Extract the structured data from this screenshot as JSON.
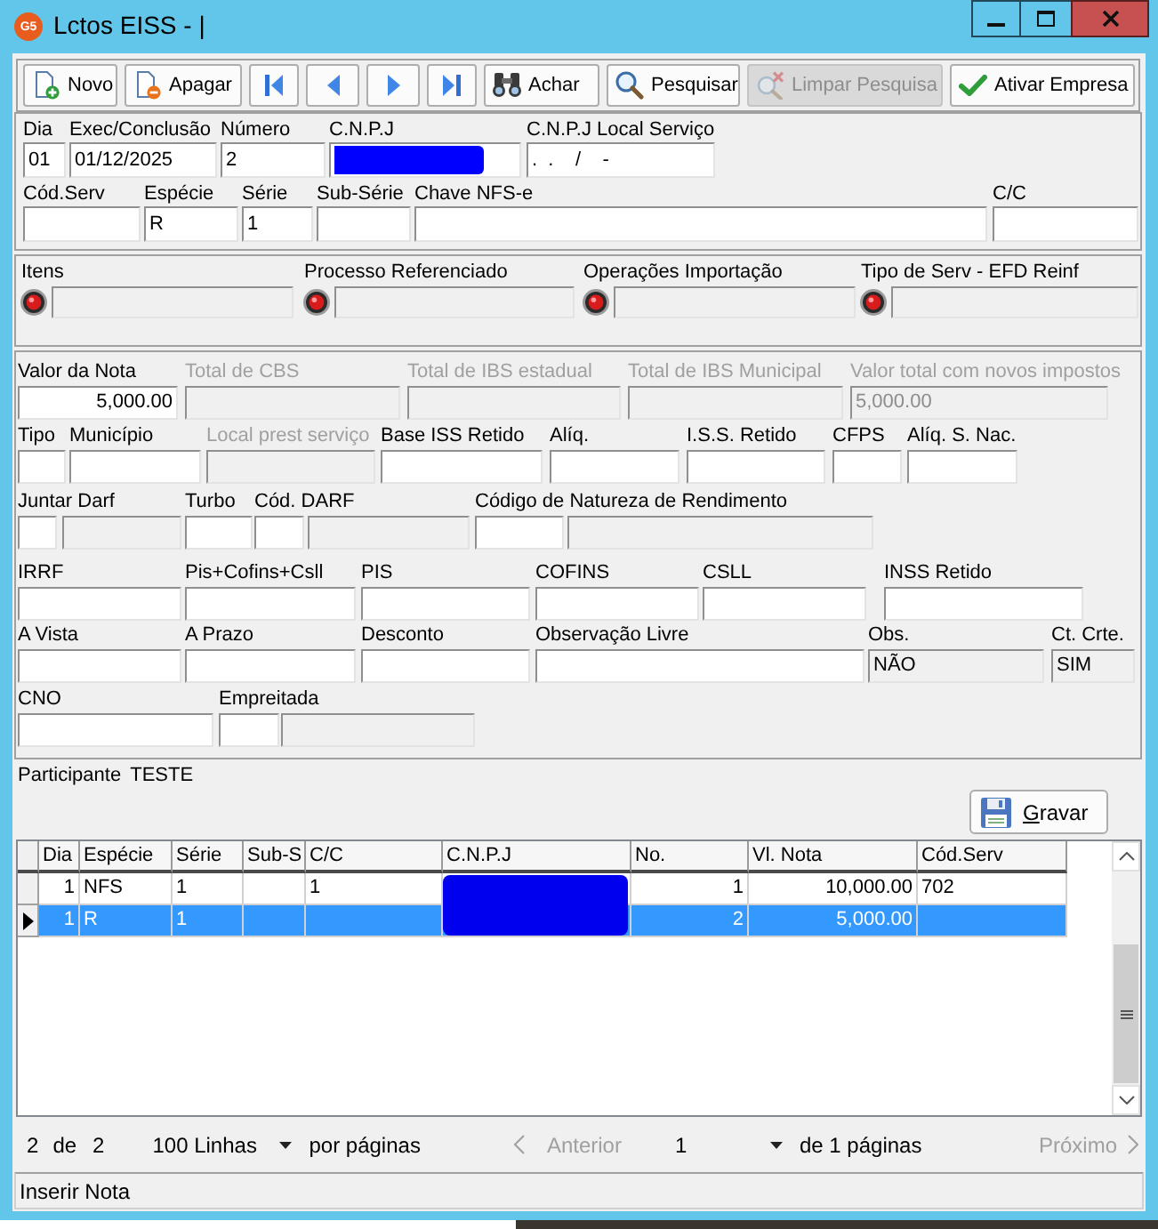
{
  "window": {
    "logo": "G5",
    "title": "Lctos EISS - |"
  },
  "toolbar": [
    {
      "kind": "new",
      "label": "Novo",
      "disabled": false
    },
    {
      "kind": "delete",
      "label": "Apagar",
      "disabled": false
    },
    {
      "kind": "first",
      "disabled": false
    },
    {
      "kind": "previous",
      "disabled": false
    },
    {
      "kind": "next",
      "disabled": false
    },
    {
      "kind": "last",
      "disabled": false
    },
    {
      "kind": "find",
      "label": "Achar",
      "disabled": false
    },
    {
      "kind": "search",
      "label": "Pesquisar",
      "disabled": false
    },
    {
      "kind": "clear",
      "label": "Limpar Pesquisa",
      "disabled": true
    },
    {
      "kind": "activate",
      "label": "Ativar Empresa",
      "disabled": false
    }
  ],
  "header": [
    [
      {
        "kind": "input",
        "label": "Dia",
        "value": "01"
      },
      {
        "kind": "input",
        "label": "Exec/Conclusão",
        "value": "01/12/2025"
      },
      {
        "kind": "input",
        "label": "Número",
        "value": "2"
      },
      {
        "kind": "redacted",
        "label": "C.N.P.J"
      },
      {
        "kind": "input",
        "label": "C.N.P.J Local Serviço",
        "value": ".  .    /    -"
      }
    ],
    [
      {
        "kind": "input",
        "label": "Cód.Serv"
      },
      {
        "kind": "input",
        "label": "Espécie",
        "value": "R"
      },
      {
        "kind": "input",
        "label": "Série",
        "value": "1"
      },
      {
        "kind": "input",
        "label": "Sub-Série"
      },
      {
        "kind": "input",
        "label": "Chave NFS-e"
      },
      {
        "kind": "input",
        "label": "C/C"
      }
    ]
  ],
  "item_links": [
    {
      "label": "Itens"
    },
    {
      "label": "Processo Referenciado"
    },
    {
      "label": "Operações Importação"
    },
    {
      "label": "Tipo de Serv - EFD Reinf"
    }
  ],
  "values": [
    [
      {
        "kind": "input",
        "label": "Valor da Nota",
        "value": "5,000.00"
      },
      {
        "kind": "disabled",
        "label": "Total de CBS"
      },
      {
        "kind": "disabled",
        "label": "Total de IBS estadual"
      },
      {
        "kind": "disabled",
        "label": "Total de IBS Municipal"
      },
      {
        "kind": "disabled",
        "label": "Valor total com novos impostos",
        "value": "5,000.00"
      }
    ],
    [
      {
        "kind": "input",
        "label": "Tipo"
      },
      {
        "kind": "input",
        "label": "Município"
      },
      {
        "kind": "disabled",
        "label": "Local prest serviço"
      },
      {
        "kind": "input",
        "label": "Base ISS Retido"
      },
      {
        "kind": "input",
        "label": "Alíq."
      },
      {
        "kind": "input",
        "label": "I.S.S. Retido"
      },
      {
        "kind": "input",
        "label": "CFPS"
      },
      {
        "kind": "input",
        "label": "Alíq. S. Nac."
      }
    ],
    [
      {
        "kind": "lookup",
        "label": "Juntar Darf"
      },
      {
        "kind": "input",
        "label": "Turbo"
      },
      {
        "kind": "lookup",
        "label": "Cód. DARF"
      },
      {
        "kind": "lookup",
        "label": "Código de Natureza de Rendimento"
      }
    ],
    [
      {
        "kind": "input",
        "label": "IRRF"
      },
      {
        "kind": "input",
        "label": "Pis+Cofins+Csll"
      },
      {
        "kind": "input",
        "label": "PIS"
      },
      {
        "kind": "input",
        "label": "COFINS"
      },
      {
        "kind": "input",
        "label": "CSLL"
      },
      {
        "kind": "input",
        "label": "INSS Retido"
      }
    ],
    [
      {
        "kind": "input",
        "label": "A Vista"
      },
      {
        "kind": "input",
        "label": "A Prazo"
      },
      {
        "kind": "input",
        "label": "Desconto"
      },
      {
        "kind": "input",
        "label": "Observação Livre"
      },
      {
        "kind": "readonly",
        "label": "Obs.",
        "value": "NÃO"
      },
      {
        "kind": "readonly",
        "label": "Ct. Crte.",
        "value": "SIM"
      }
    ],
    [
      {
        "kind": "input",
        "label": "CNO"
      },
      {
        "kind": "lookup",
        "label": "Empreitada"
      }
    ]
  ],
  "participant": {
    "label": "Participante",
    "name": "TESTE"
  },
  "save_button": {
    "label": "Gravar",
    "mnemonic": true
  },
  "table": {
    "columns": [
      "Dia",
      "Espécie",
      "Série",
      "Sub-S",
      "C/C",
      "C.N.P.J",
      "No.",
      "Vl. Nota",
      "Cód.Serv"
    ],
    "cnpj_redacted": true,
    "rows": [
      {
        "selected": false,
        "dia": "1",
        "especie": "NFS",
        "serie": "1",
        "cc": "1",
        "no": "1",
        "vl_nota": "10,000.00",
        "cod_serv": "702"
      },
      {
        "selected": true,
        "dia": "1",
        "especie": "R",
        "serie": "1",
        "no": "2",
        "vl_nota": "5,000.00"
      }
    ]
  },
  "pagination": {
    "shown": "2",
    "of": "de",
    "total": "2",
    "page_size": "100 Linhas",
    "per_page": "por páginas",
    "previous": {
      "label": "Anterior",
      "disabled": true
    },
    "page": "1",
    "page_count": "de 1 páginas",
    "next": {
      "label": "Próximo",
      "disabled": true
    }
  },
  "status_bar": {
    "text": "Inserir Nota"
  }
}
